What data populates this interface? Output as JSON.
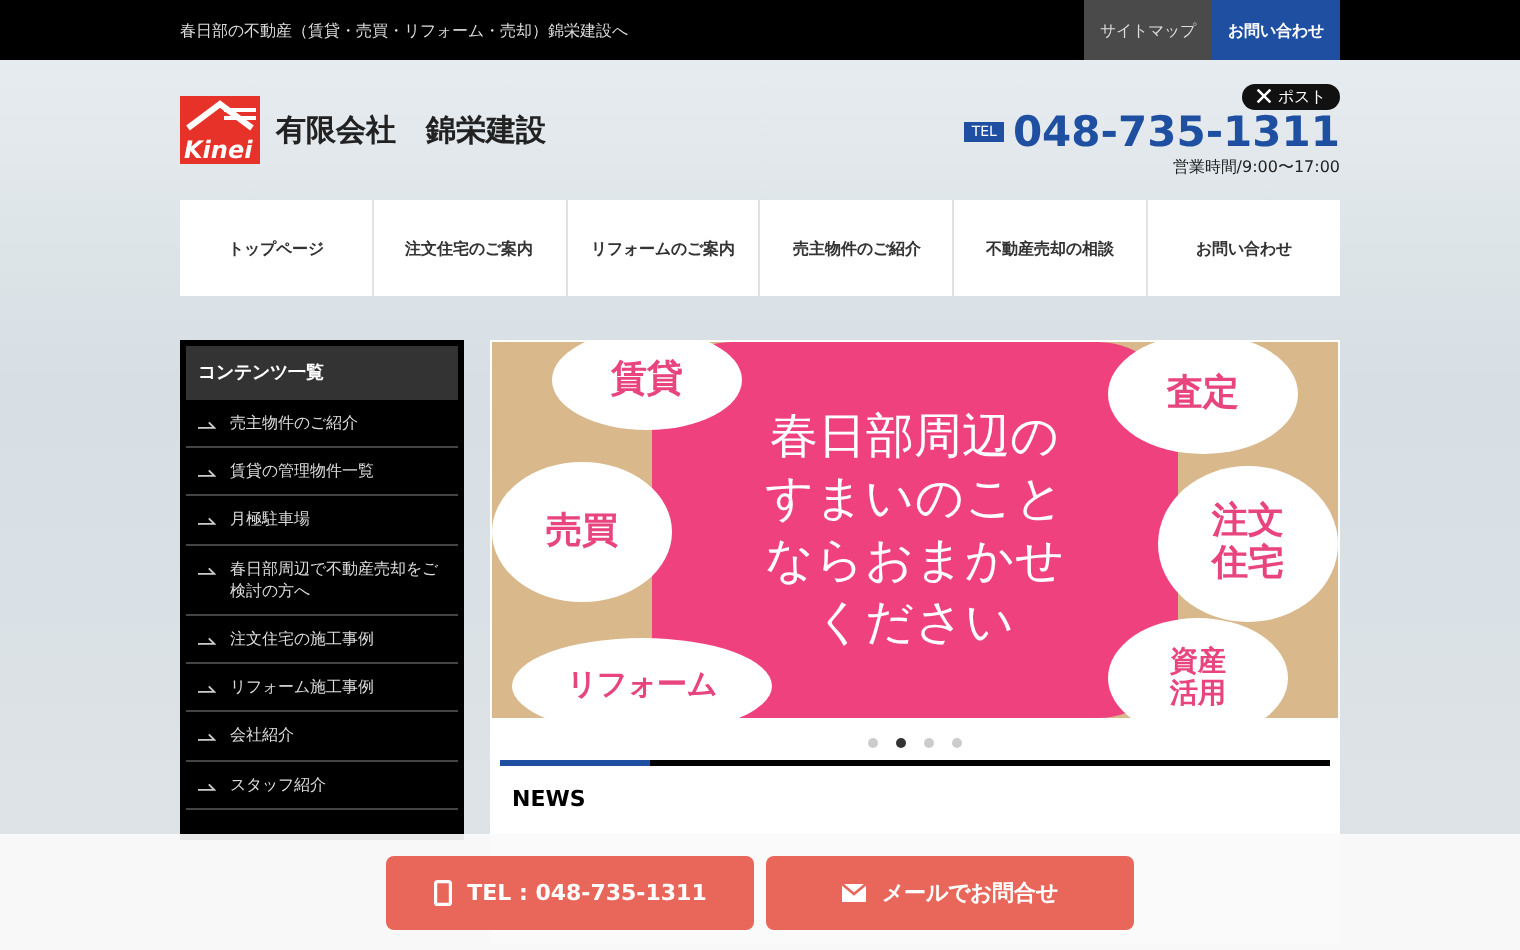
{
  "top_bar": {
    "tagline": "春日部の不動産（賃貸・売買・リフォーム・売却）錦栄建設へ",
    "links": [
      {
        "label": "サイトマップ",
        "kind": "plain"
      },
      {
        "label": "お問い合わせ",
        "kind": "accent"
      }
    ]
  },
  "header": {
    "logo_text": "Kinei",
    "company": "有限会社　錦栄建設",
    "post_button": "ポスト",
    "tel_badge": "TEL",
    "phone": "048-735-1311",
    "hours": "営業時間/9:00〜17:00"
  },
  "nav": [
    "トップページ",
    "注文住宅のご案内",
    "リフォームのご案内",
    "売主物件のご紹介",
    "不動産売却の相談",
    "お問い合わせ"
  ],
  "sidebar": {
    "title": "コンテンツ一覧",
    "items": [
      "売主物件のご紹介",
      "賃貸の管理物件一覧",
      "月極駐車場",
      "春日部周辺で不動産売却をご検討の方へ",
      "注文住宅の施工事例",
      "リフォーム施工事例",
      "会社紹介",
      "スタッフ紹介"
    ]
  },
  "banner": {
    "headline": [
      "春日部周辺の",
      "すまいのこと",
      "ならおまかせ",
      "ください"
    ],
    "bubbles": [
      "賃貸",
      "売買",
      "リフォーム",
      "査定",
      "注文住宅",
      "資産活用"
    ],
    "dots": [
      {
        "selected": false
      },
      {
        "selected": true
      },
      {
        "selected": false
      },
      {
        "selected": false
      }
    ],
    "progress": {
      "level": 0.18
    }
  },
  "news_heading": "NEWS",
  "footer_buttons": [
    {
      "label": "TEL : 048-735-1311",
      "kind": "phone"
    },
    {
      "label": "メールでお問合せ",
      "kind": "mail"
    }
  ]
}
